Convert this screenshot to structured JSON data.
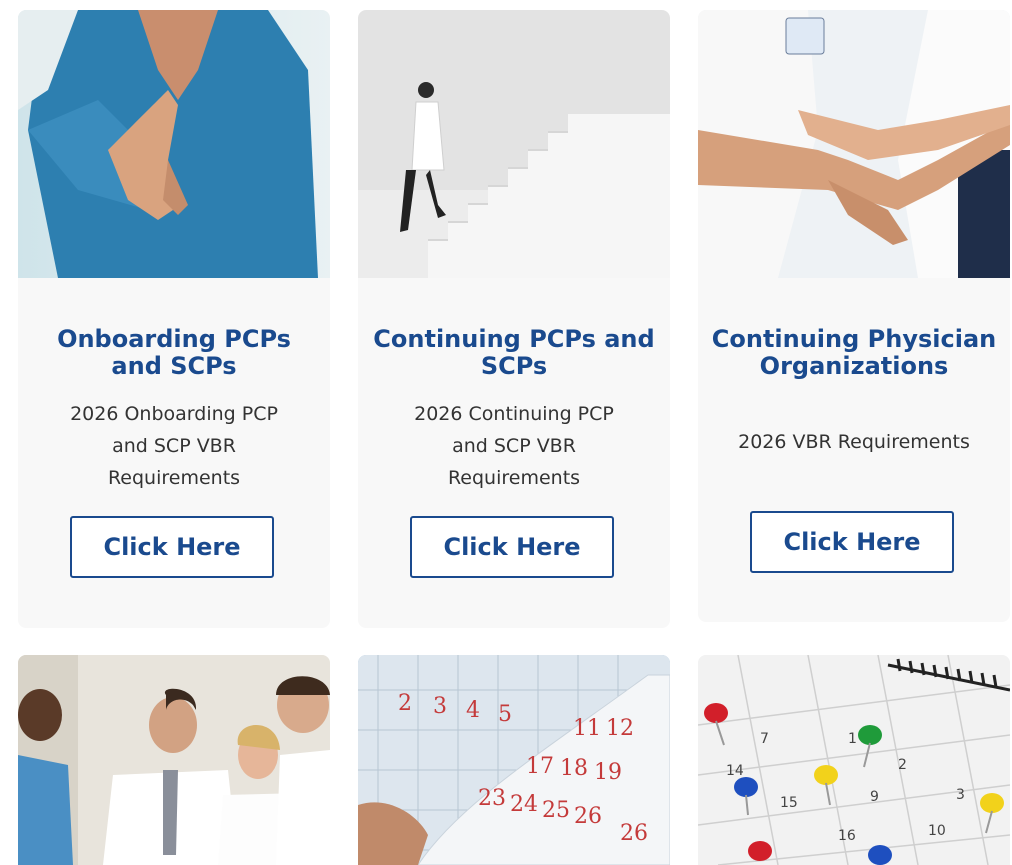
{
  "cards": [
    {
      "title": "Onboarding PCPs and SCPs",
      "description": "2026 Onboarding PCP and SCP VBR Requirements",
      "button_label": "Click Here",
      "image_icon": "handshake-photo"
    },
    {
      "title": "Continuing PCPs and SCPs",
      "description": "2026 Continuing PCP and SCP VBR Requirements",
      "button_label": "Click Here",
      "image_icon": "doctor-stairs-photo"
    },
    {
      "title": "Continuing Physician Organizations",
      "description": "2026 VBR Requirements",
      "button_label": "Click Here",
      "image_icon": "team-hands-photo"
    }
  ],
  "bottom_images": [
    {
      "image_icon": "medical-team-photo"
    },
    {
      "image_icon": "calendar-pages-photo",
      "calendar_numbers": [
        "2",
        "3",
        "4",
        "5",
        "11",
        "12",
        "17",
        "18",
        "19",
        "23",
        "24",
        "25",
        "26",
        "26"
      ]
    },
    {
      "image_icon": "calendar-pins-photo",
      "calendar_numbers": [
        "7",
        "1",
        "2",
        "14",
        "15",
        "9",
        "3",
        "16",
        "10"
      ]
    }
  ],
  "colors": {
    "brand_blue": "#1a4a8e",
    "card_bg": "#f8f8f8",
    "text_gray": "#333333"
  }
}
